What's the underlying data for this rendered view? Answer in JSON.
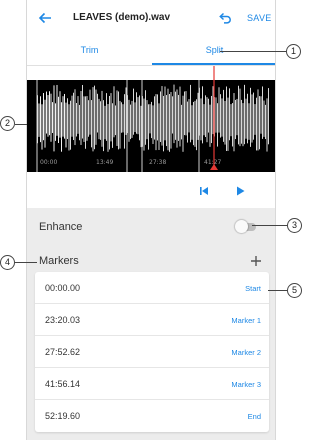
{
  "header": {
    "title": "LEAVES (demo).wav",
    "save_label": "SAVE"
  },
  "tabs": [
    {
      "label": "Trim"
    },
    {
      "label": "Split"
    }
  ],
  "waveform": {
    "ticks": [
      "00:00",
      "13:49",
      "27:38",
      "41:27"
    ]
  },
  "enhance": {
    "label": "Enhance",
    "enabled": false
  },
  "markers": {
    "label": "Markers",
    "items": [
      {
        "time": "00:00.00",
        "name": "Start"
      },
      {
        "time": "23:20.03",
        "name": "Marker 1"
      },
      {
        "time": "27:52.62",
        "name": "Marker 2"
      },
      {
        "time": "41:56.14",
        "name": "Marker 3"
      },
      {
        "time": "52:19.60",
        "name": "End"
      }
    ]
  },
  "callouts": [
    "1",
    "2",
    "3",
    "4",
    "5"
  ],
  "colors": {
    "accent": "#1e88e5",
    "playhead": "#e53935",
    "waveform_bg": "#000000"
  }
}
